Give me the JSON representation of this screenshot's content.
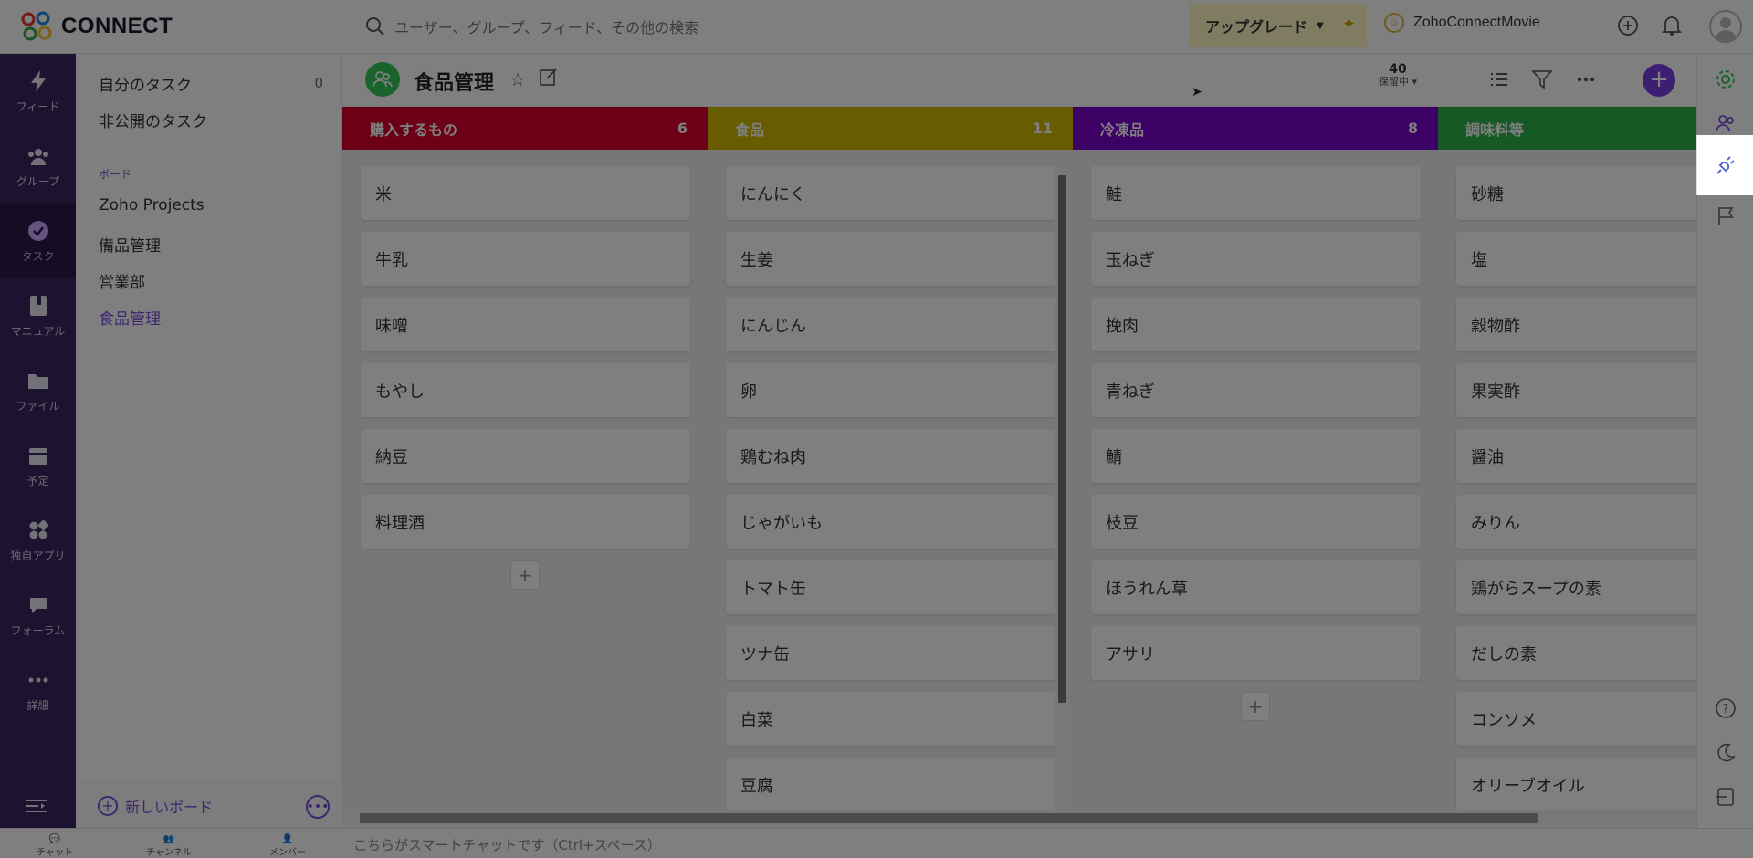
{
  "app": {
    "logo_text": "CONNECT"
  },
  "search": {
    "placeholder": "ユーザー、グループ、フィード、その他の検索"
  },
  "upgrade": {
    "label": "アップグレード"
  },
  "org": {
    "name": "ZohoConnectMovie"
  },
  "nav": [
    {
      "label": "フィード",
      "icon": "bolt-icon"
    },
    {
      "label": "グループ",
      "icon": "group-icon"
    },
    {
      "label": "タスク",
      "icon": "task-check-icon",
      "active": true
    },
    {
      "label": "マニュアル",
      "icon": "manual-book-icon"
    },
    {
      "label": "ファイル",
      "icon": "folder-icon"
    },
    {
      "label": "予定",
      "icon": "calendar-icon"
    },
    {
      "label": "独自アプリ",
      "icon": "apps-icon"
    },
    {
      "label": "フォーラム",
      "icon": "forum-icon"
    },
    {
      "label": "詳細",
      "icon": "more-dots-icon"
    }
  ],
  "sidebar": {
    "my_tasks": "自分のタスク",
    "my_tasks_count": "0",
    "private_tasks": "非公開のタスク",
    "section_boards": "ボード",
    "boards": [
      "Zoho Projects",
      "備品管理",
      "営業部",
      "食品管理"
    ],
    "new_board": "新しいボード"
  },
  "board": {
    "title": "食品管理",
    "hold_count": "40",
    "hold_label": "保留中"
  },
  "columns": [
    {
      "title": "購入するもの",
      "count": "6",
      "color": "#d7002f",
      "cards": [
        "米",
        "牛乳",
        "味噌",
        "もやし",
        "納豆",
        "料理酒"
      ]
    },
    {
      "title": "食品",
      "count": "11",
      "color": "#cfb800",
      "cards": [
        "にんにく",
        "生姜",
        "にんじん",
        "卵",
        "鶏むね肉",
        "じゃがいも",
        "トマト缶",
        "ツナ缶",
        "白菜",
        "豆腐"
      ]
    },
    {
      "title": "冷凍品",
      "count": "8",
      "color": "#7a00c8",
      "cards": [
        "鮭",
        "玉ねぎ",
        "挽肉",
        "青ねぎ",
        "鯖",
        "枝豆",
        "ほうれん草",
        "アサリ"
      ]
    },
    {
      "title": "調味料等",
      "count": "",
      "color": "#2fb34a",
      "cards": [
        "砂糖",
        "塩",
        "穀物酢",
        "果実酢",
        "醤油",
        "みりん",
        "鶏がらスープの素",
        "だしの素",
        "コンソメ",
        "オリーブオイル"
      ]
    }
  ],
  "bottom": {
    "tabs": [
      "チャット",
      "チャンネル",
      "メンバー"
    ],
    "hint": "こちらがスマートチャットです（Ctrl+スペース）"
  }
}
